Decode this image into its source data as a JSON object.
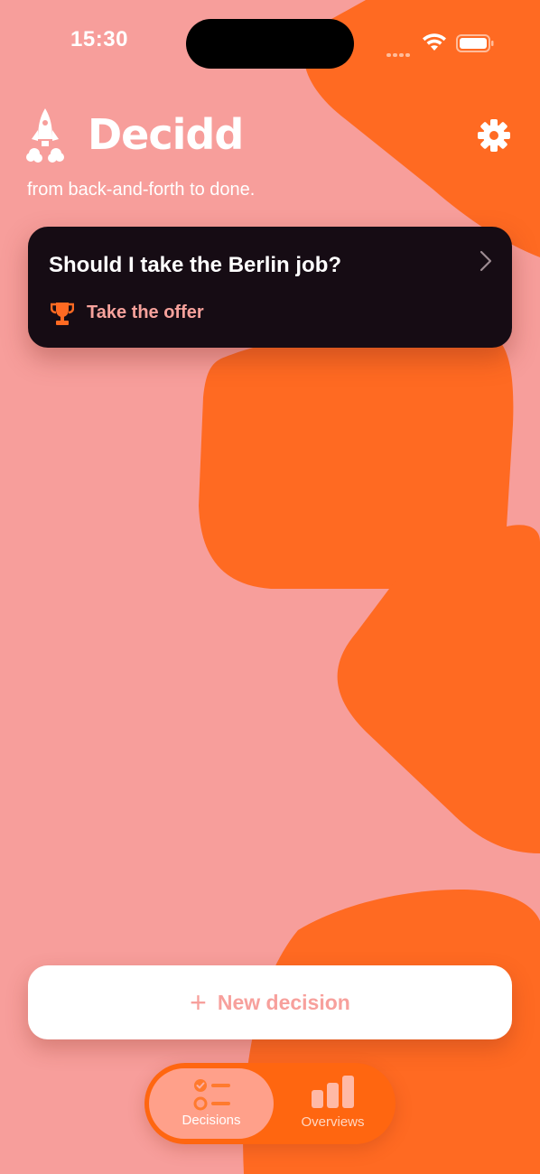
{
  "status_bar": {
    "time": "15:30"
  },
  "header": {
    "app_name": "Decidd",
    "tagline": "from back-and-forth to done."
  },
  "icons": {
    "logo": "rocket-icon",
    "settings": "gear-icon",
    "chevron": "chevron-right-icon",
    "trophy": "trophy-icon",
    "plus": "plus-icon",
    "decisions_tab": "checklist-icon",
    "overviews_tab": "bar-chart-icon"
  },
  "decisions": [
    {
      "title": "Should I take the Berlin job?",
      "outcome": "Take the offer"
    }
  ],
  "actions": {
    "new_decision": "New decision"
  },
  "tabs": [
    {
      "label": "Decisions",
      "selected": true
    },
    {
      "label": "Overviews",
      "selected": false
    }
  ],
  "colors": {
    "background": "#f79e9b",
    "accent": "#ff6610",
    "card": "#160c14",
    "outcome_text": "#f7a29c"
  }
}
